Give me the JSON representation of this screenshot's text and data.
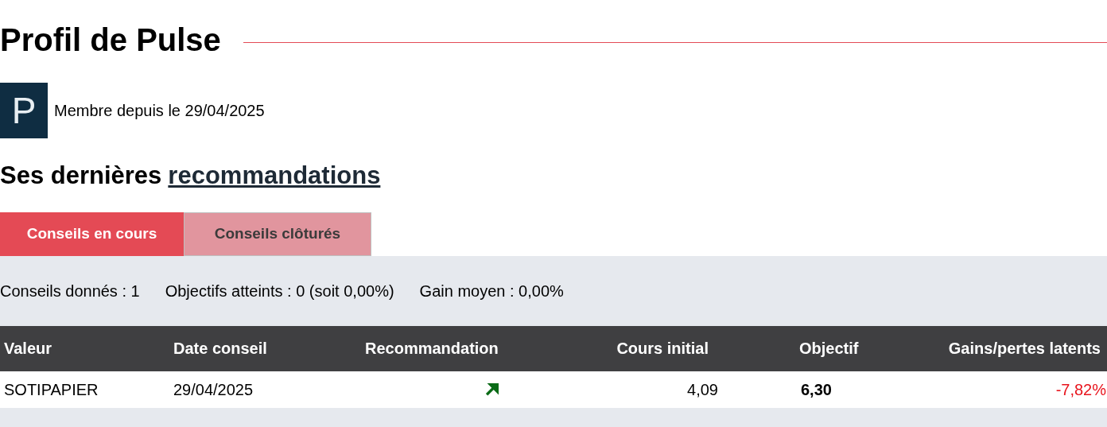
{
  "profile": {
    "title": "Profil de Pulse",
    "avatar_letter": "P",
    "member_since": "Membre depuis le 29/04/2025"
  },
  "section": {
    "title_prefix": "Ses dernières",
    "title_link": "recommandations"
  },
  "tabs": [
    {
      "label": "Conseils en cours",
      "selected": true
    },
    {
      "label": "Conseils clôturés",
      "selected": false
    }
  ],
  "stats": [
    "Conseils donnés : 1",
    "Objectifs atteints : 0 (soit 0,00%)",
    "Gain moyen : 0,00%"
  ],
  "table": {
    "columns": [
      "Valeur",
      "Date conseil",
      "Recommandation",
      "Cours initial",
      "Objectif",
      "Gains/pertes latents"
    ],
    "rows": [
      {
        "valeur": "SOTIPAPIER",
        "date": "29/04/2025",
        "kind": "up",
        "cours_initial": "4,09",
        "objectif": "6,30",
        "gain": "-7,82%",
        "gain_negative": true
      }
    ]
  }
}
